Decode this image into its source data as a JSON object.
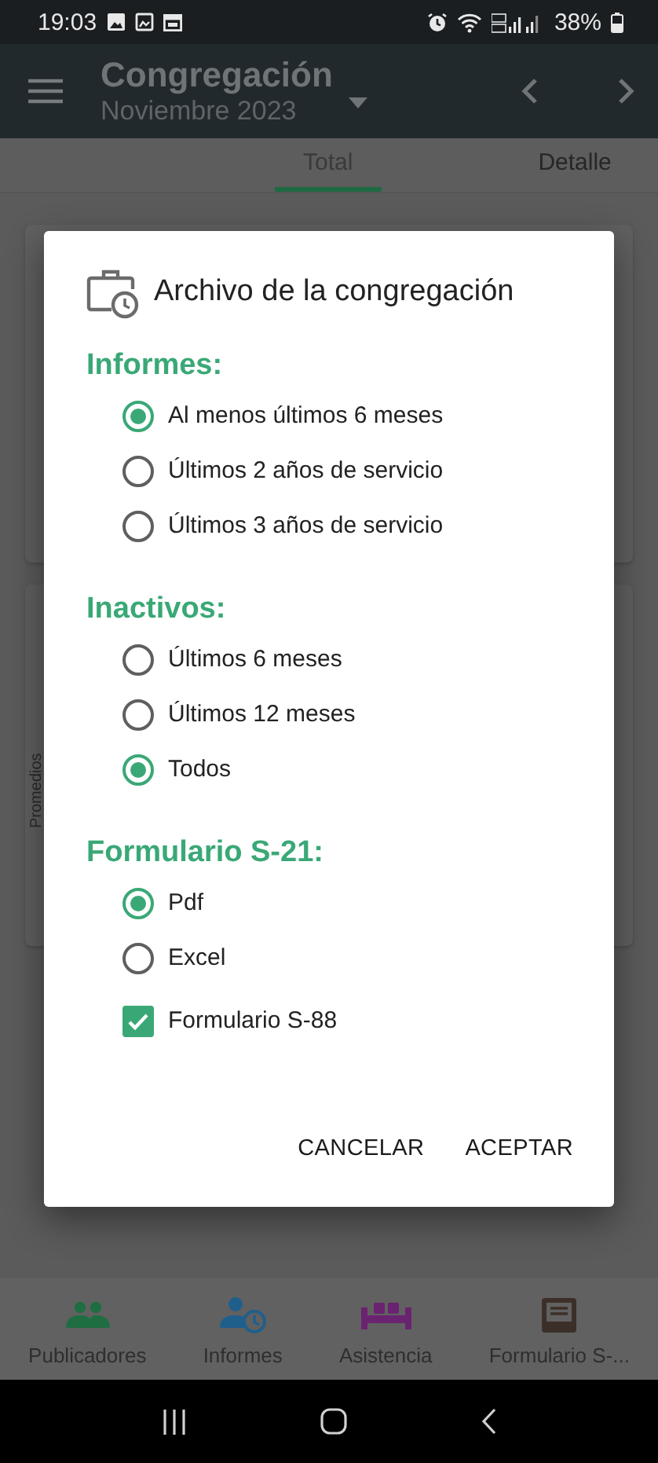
{
  "status_bar": {
    "time": "19:03",
    "battery": "38%"
  },
  "app_bar": {
    "title": "Congregación",
    "subtitle": "Noviembre 2023"
  },
  "tabs": [
    {
      "label": "Total",
      "selected": true
    },
    {
      "label": "Detalle",
      "selected": false
    }
  ],
  "background": {
    "side_label": "Promedios"
  },
  "dialog": {
    "title": "Archivo de la congregación",
    "sections": [
      {
        "heading": "Informes:",
        "options": [
          {
            "kind": "radio",
            "label": "Al menos últimos 6 meses",
            "selected": true
          },
          {
            "kind": "radio",
            "label": "Últimos 2 años de servicio",
            "selected": false
          },
          {
            "kind": "radio",
            "label": "Últimos 3 años de servicio",
            "selected": false
          }
        ]
      },
      {
        "heading": "Inactivos:",
        "options": [
          {
            "kind": "radio",
            "label": "Últimos 6 meses",
            "selected": false
          },
          {
            "kind": "radio",
            "label": "Últimos 12 meses",
            "selected": false
          },
          {
            "kind": "radio",
            "label": "Todos",
            "selected": true
          }
        ]
      },
      {
        "heading": "Formulario S-21:",
        "options": [
          {
            "kind": "radio",
            "label": "Pdf",
            "selected": true
          },
          {
            "kind": "radio",
            "label": "Excel",
            "selected": false
          },
          {
            "kind": "checkbox",
            "label": "Formulario S-88",
            "checked": true
          }
        ]
      }
    ],
    "buttons": [
      "CANCELAR",
      "ACEPTAR"
    ]
  },
  "bottom_nav": [
    {
      "label": "Publicadores",
      "color": "#1e6e42"
    },
    {
      "label": "Informes",
      "color": "#1f5f8c"
    },
    {
      "label": "Asistencia",
      "color": "#6a2370"
    },
    {
      "label": "Formulario S-...",
      "color": "#3c2f2a"
    }
  ]
}
